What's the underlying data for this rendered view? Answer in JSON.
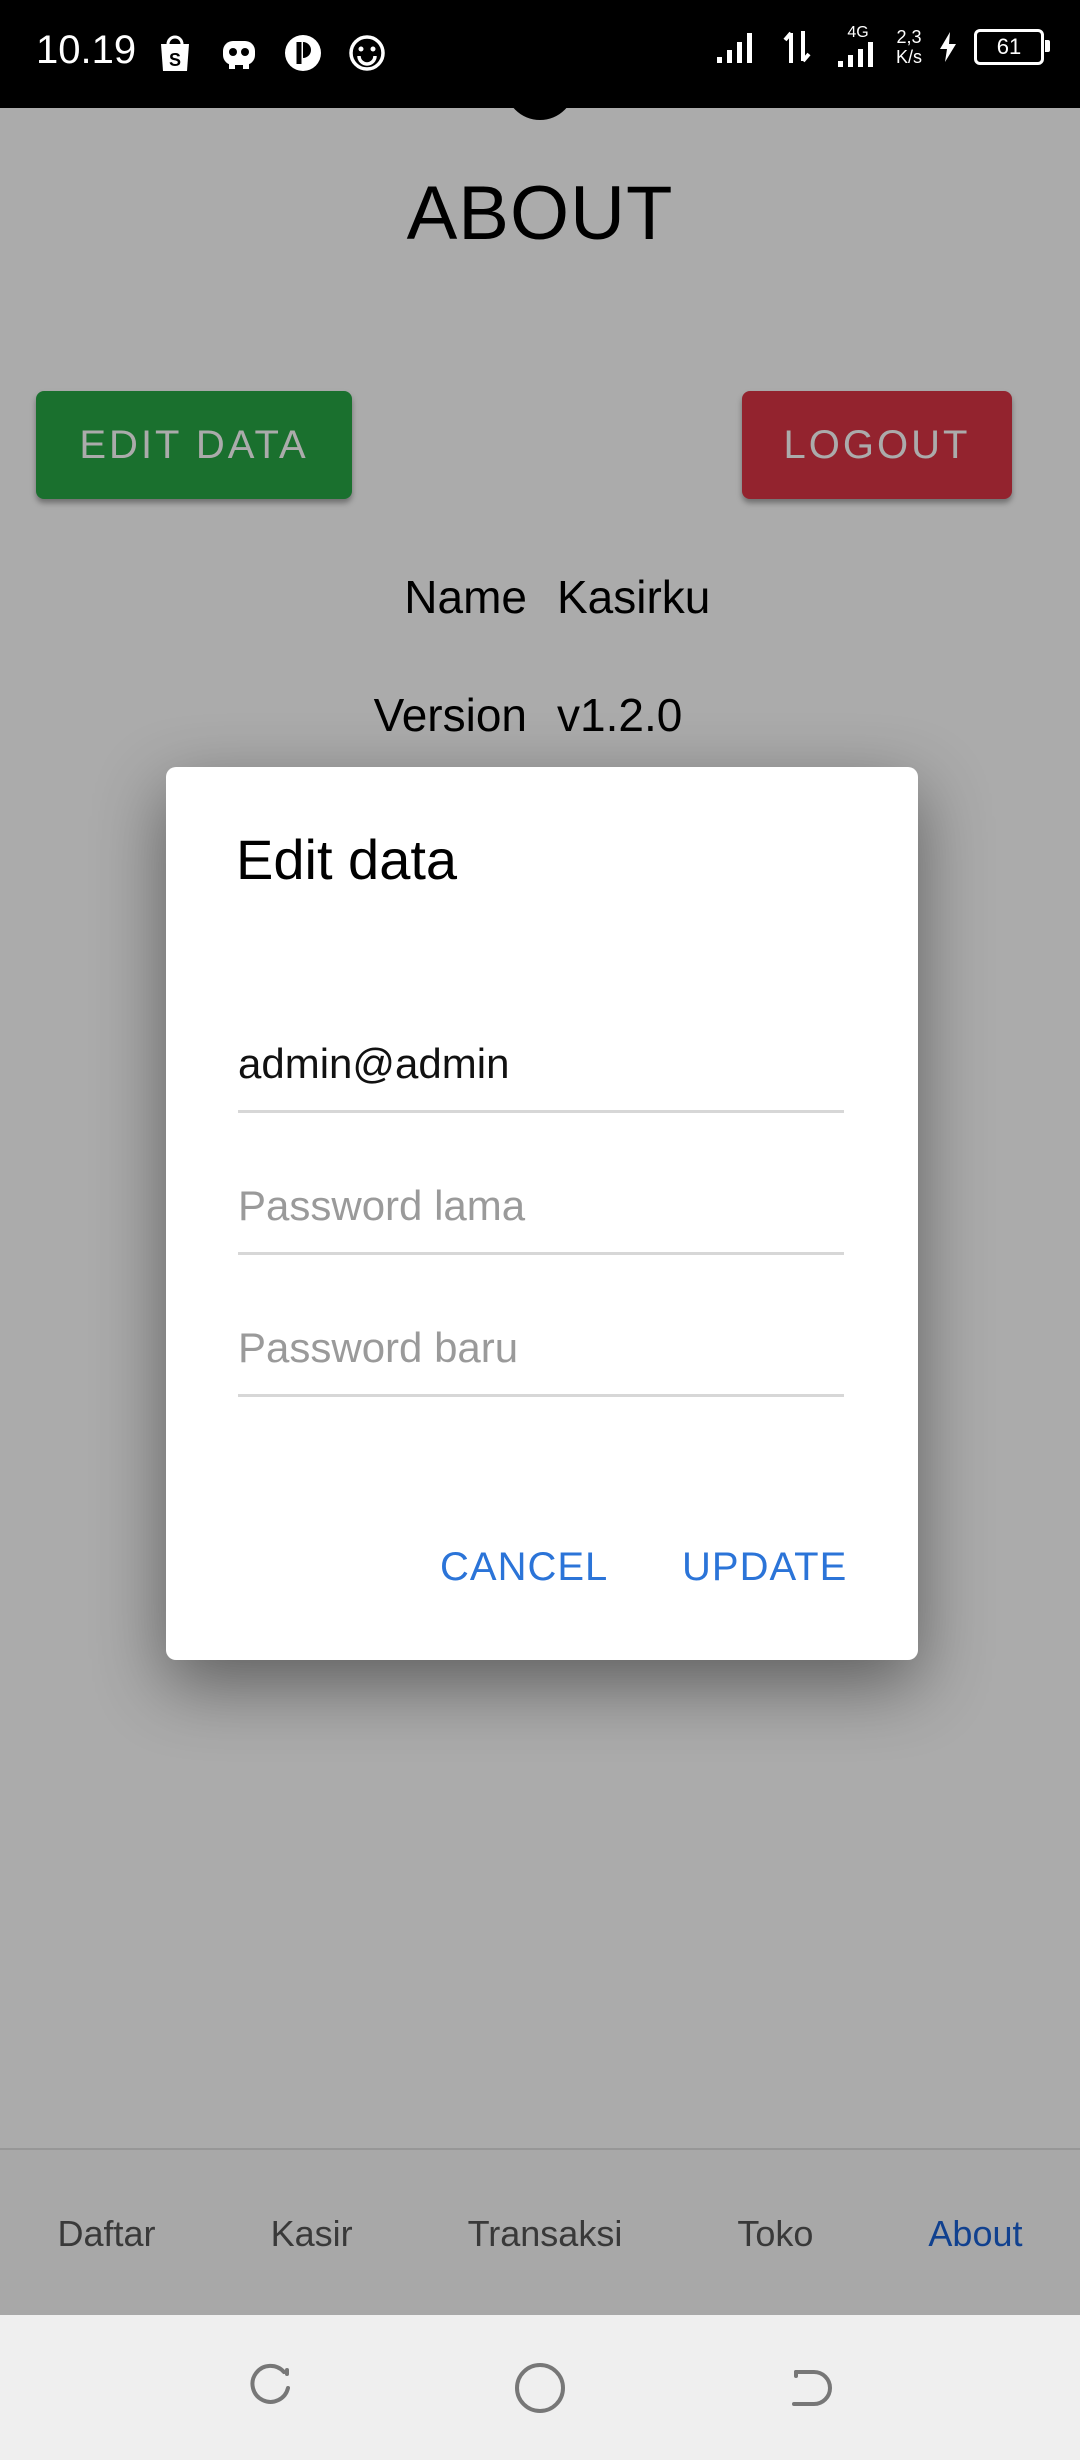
{
  "status_bar": {
    "time": "10.19",
    "left_icons": [
      "shopee-bag-icon",
      "bot-icon",
      "half-circle-app-icon",
      "smiley-icon"
    ],
    "network_type": "4G",
    "net_speed_value": "2,3",
    "net_speed_unit": "K/s",
    "battery_level": "61"
  },
  "page": {
    "title": "ABOUT",
    "edit_button_label": "EDIT DATA",
    "logout_button_label": "LOGOUT",
    "colors": {
      "edit": "#28a745",
      "logout": "#dc3545"
    },
    "info": [
      {
        "label": "Name",
        "value": "Kasirku"
      },
      {
        "label": "Version",
        "value": "v1.2.0"
      }
    ]
  },
  "dialog": {
    "title": "Edit data",
    "fields": {
      "email_value": "admin@admin",
      "old_password_placeholder": "Password lama",
      "new_password_placeholder": "Password baru"
    },
    "cancel_label": "CANCEL",
    "update_label": "UPDATE",
    "accent": "#2b74d8"
  },
  "bottom_nav": {
    "items": [
      "Daftar",
      "Kasir",
      "Transaksi",
      "Toko",
      "About"
    ],
    "active": "About"
  },
  "system_nav": [
    "recent-apps-icon",
    "home-icon",
    "back-icon"
  ]
}
